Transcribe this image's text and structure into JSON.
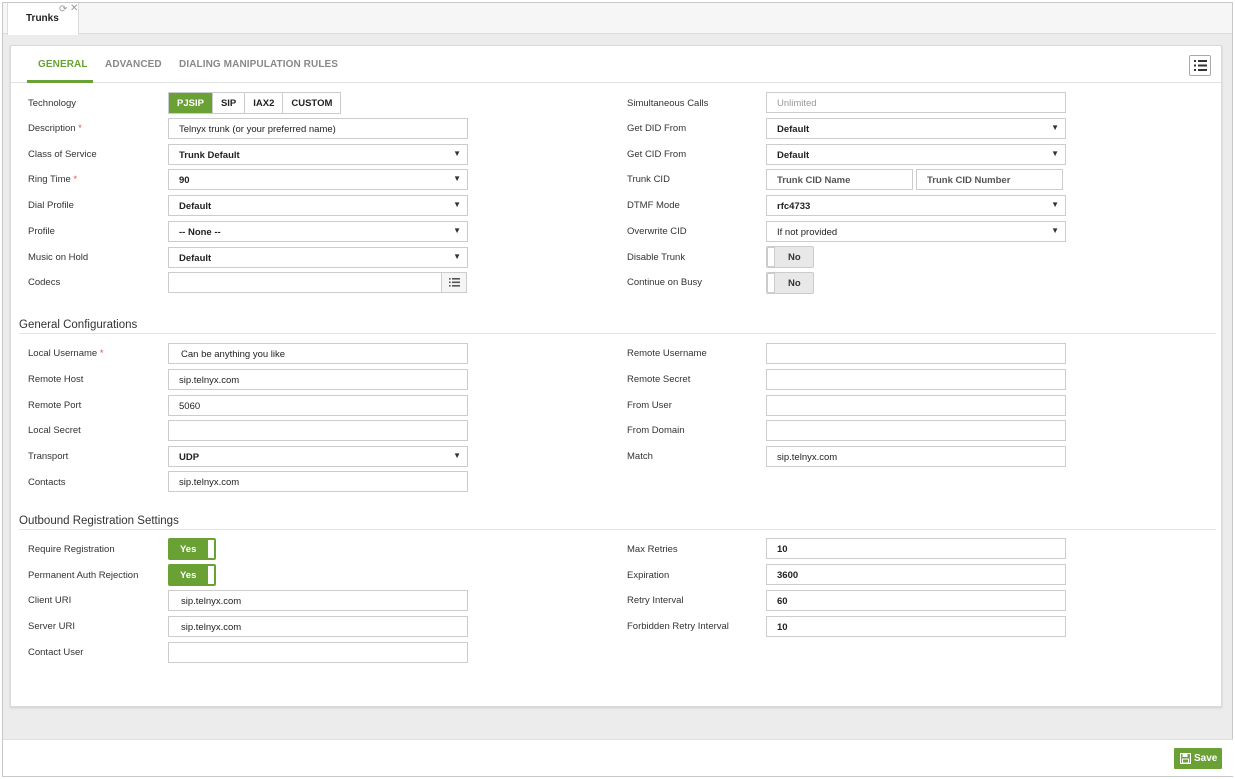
{
  "tabstrip": {
    "title": "Trunks",
    "refresh_icon": "refresh-icon",
    "close_icon": "close-icon"
  },
  "tabs": [
    "GENERAL",
    "ADVANCED",
    "DIALING MANIPULATION RULES"
  ],
  "active_tab": "GENERAL",
  "colors": {
    "accent": "#6aa135",
    "required": "#d9534f"
  },
  "left": {
    "technology": {
      "label": "Technology",
      "options": [
        "PJSIP",
        "SIP",
        "IAX2",
        "CUSTOM"
      ],
      "selected": "PJSIP"
    },
    "description": {
      "label": "Description",
      "value": "Telnyx trunk (or your preferred name)"
    },
    "class_of_service": {
      "label": "Class of Service",
      "value": "Trunk Default"
    },
    "ring_time": {
      "label": "Ring Time",
      "value": "90"
    },
    "dial_profile": {
      "label": "Dial Profile",
      "value": "Default"
    },
    "profile": {
      "label": "Profile",
      "value": "-- None --"
    },
    "music_on_hold": {
      "label": "Music on Hold",
      "value": "Default"
    },
    "codecs": {
      "label": "Codecs",
      "value": ""
    }
  },
  "right": {
    "simultaneous_calls": {
      "label": "Simultaneous Calls",
      "placeholder": "Unlimited"
    },
    "get_did_from": {
      "label": "Get DID From",
      "value": "Default"
    },
    "get_cid_from": {
      "label": "Get CID From",
      "value": "Default"
    },
    "trunk_cid": {
      "label": "Trunk CID",
      "name_placeholder": "Trunk CID Name",
      "number_placeholder": "Trunk CID Number"
    },
    "dtmf_mode": {
      "label": "DTMF Mode",
      "value": "rfc4733"
    },
    "overwrite_cid": {
      "label": "Overwrite CID",
      "value": "If not provided"
    },
    "disable_trunk": {
      "label": "Disable Trunk",
      "value": "No"
    },
    "continue_on_busy": {
      "label": "Continue on Busy",
      "value": "No"
    }
  },
  "general_config": {
    "title": "General Configurations",
    "local_username": {
      "label": "Local Username",
      "value": "Can be anything you like"
    },
    "remote_host": {
      "label": "Remote Host",
      "value": "sip.telnyx.com"
    },
    "remote_port": {
      "label": "Remote Port",
      "value": "5060"
    },
    "local_secret": {
      "label": "Local Secret",
      "value": ""
    },
    "transport": {
      "label": "Transport",
      "value": "UDP"
    },
    "contacts": {
      "label": "Contacts",
      "value": "sip.telnyx.com"
    },
    "remote_username": {
      "label": "Remote Username",
      "value": ""
    },
    "remote_secret": {
      "label": "Remote Secret",
      "value": ""
    },
    "from_user": {
      "label": "From User",
      "value": ""
    },
    "from_domain": {
      "label": "From Domain",
      "value": ""
    },
    "match": {
      "label": "Match",
      "value": "sip.telnyx.com"
    }
  },
  "outbound": {
    "title": "Outbound Registration Settings",
    "require_registration": {
      "label": "Require Registration",
      "value": "Yes"
    },
    "permanent_auth_rejection": {
      "label": "Permanent Auth Rejection",
      "value": "Yes"
    },
    "client_uri": {
      "label": "Client URI",
      "value": "sip.telnyx.com"
    },
    "server_uri": {
      "label": "Server URI",
      "value": "sip.telnyx.com"
    },
    "contact_user": {
      "label": "Contact User",
      "value": ""
    },
    "max_retries": {
      "label": "Max Retries",
      "value": "10"
    },
    "expiration": {
      "label": "Expiration",
      "value": "3600"
    },
    "retry_interval": {
      "label": "Retry Interval",
      "value": "60"
    },
    "forbidden_retry_interval": {
      "label": "Forbidden Retry Interval",
      "value": "10"
    }
  },
  "save_label": "Save",
  "required_mark": "*",
  "select_arrow": "▼"
}
